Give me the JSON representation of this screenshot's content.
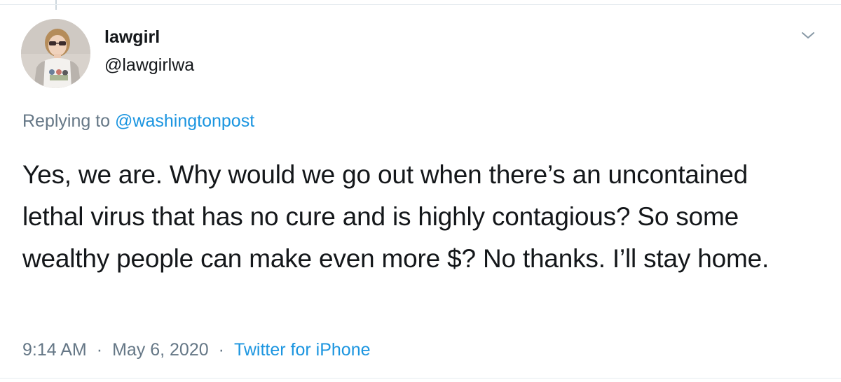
{
  "tweet": {
    "author": {
      "display_name": "lawgirl",
      "handle": "@lawgirlwa",
      "avatar_icon": "avatar-photo"
    },
    "menu_icon": "chevron-down-icon",
    "replying_prefix": "Replying to",
    "replying_to": "@washingtonpost",
    "body": "Yes, we are. Why would we go out when there’s an uncontained lethal virus that has no cure and is highly contagious? So some wealthy people can make even more $? No thanks. I’ll stay home.",
    "time": "9:14 AM",
    "separator": "·",
    "date": "May 6, 2020",
    "source": "Twitter for iPhone"
  },
  "colors": {
    "text": "#14171a",
    "secondary": "#657786",
    "link": "#1b95e0",
    "border": "#e6ecf0"
  }
}
